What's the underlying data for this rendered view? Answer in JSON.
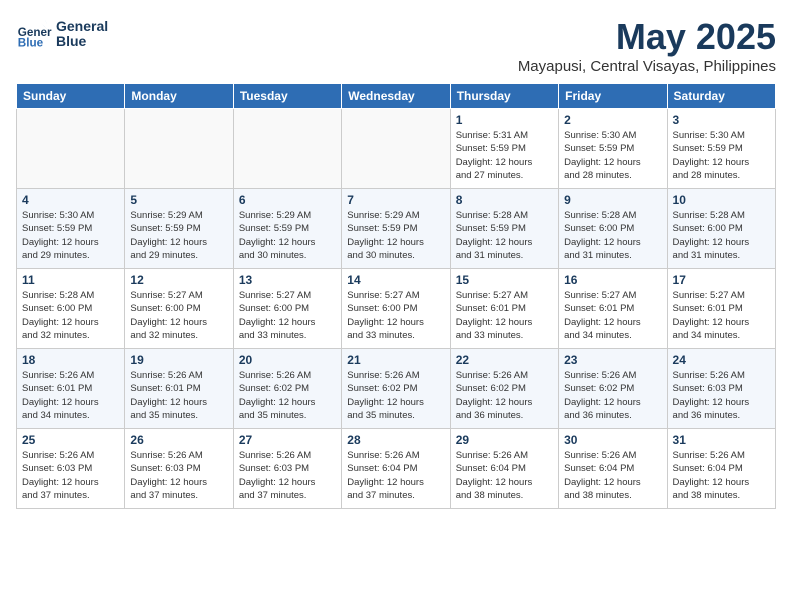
{
  "header": {
    "logo_line1": "General",
    "logo_line2": "Blue",
    "month_title": "May 2025",
    "location": "Mayapusi, Central Visayas, Philippines"
  },
  "weekdays": [
    "Sunday",
    "Monday",
    "Tuesday",
    "Wednesday",
    "Thursday",
    "Friday",
    "Saturday"
  ],
  "weeks": [
    [
      {
        "day": "",
        "info": ""
      },
      {
        "day": "",
        "info": ""
      },
      {
        "day": "",
        "info": ""
      },
      {
        "day": "",
        "info": ""
      },
      {
        "day": "1",
        "info": "Sunrise: 5:31 AM\nSunset: 5:59 PM\nDaylight: 12 hours\nand 27 minutes."
      },
      {
        "day": "2",
        "info": "Sunrise: 5:30 AM\nSunset: 5:59 PM\nDaylight: 12 hours\nand 28 minutes."
      },
      {
        "day": "3",
        "info": "Sunrise: 5:30 AM\nSunset: 5:59 PM\nDaylight: 12 hours\nand 28 minutes."
      }
    ],
    [
      {
        "day": "4",
        "info": "Sunrise: 5:30 AM\nSunset: 5:59 PM\nDaylight: 12 hours\nand 29 minutes."
      },
      {
        "day": "5",
        "info": "Sunrise: 5:29 AM\nSunset: 5:59 PM\nDaylight: 12 hours\nand 29 minutes."
      },
      {
        "day": "6",
        "info": "Sunrise: 5:29 AM\nSunset: 5:59 PM\nDaylight: 12 hours\nand 30 minutes."
      },
      {
        "day": "7",
        "info": "Sunrise: 5:29 AM\nSunset: 5:59 PM\nDaylight: 12 hours\nand 30 minutes."
      },
      {
        "day": "8",
        "info": "Sunrise: 5:28 AM\nSunset: 5:59 PM\nDaylight: 12 hours\nand 31 minutes."
      },
      {
        "day": "9",
        "info": "Sunrise: 5:28 AM\nSunset: 6:00 PM\nDaylight: 12 hours\nand 31 minutes."
      },
      {
        "day": "10",
        "info": "Sunrise: 5:28 AM\nSunset: 6:00 PM\nDaylight: 12 hours\nand 31 minutes."
      }
    ],
    [
      {
        "day": "11",
        "info": "Sunrise: 5:28 AM\nSunset: 6:00 PM\nDaylight: 12 hours\nand 32 minutes."
      },
      {
        "day": "12",
        "info": "Sunrise: 5:27 AM\nSunset: 6:00 PM\nDaylight: 12 hours\nand 32 minutes."
      },
      {
        "day": "13",
        "info": "Sunrise: 5:27 AM\nSunset: 6:00 PM\nDaylight: 12 hours\nand 33 minutes."
      },
      {
        "day": "14",
        "info": "Sunrise: 5:27 AM\nSunset: 6:00 PM\nDaylight: 12 hours\nand 33 minutes."
      },
      {
        "day": "15",
        "info": "Sunrise: 5:27 AM\nSunset: 6:01 PM\nDaylight: 12 hours\nand 33 minutes."
      },
      {
        "day": "16",
        "info": "Sunrise: 5:27 AM\nSunset: 6:01 PM\nDaylight: 12 hours\nand 34 minutes."
      },
      {
        "day": "17",
        "info": "Sunrise: 5:27 AM\nSunset: 6:01 PM\nDaylight: 12 hours\nand 34 minutes."
      }
    ],
    [
      {
        "day": "18",
        "info": "Sunrise: 5:26 AM\nSunset: 6:01 PM\nDaylight: 12 hours\nand 34 minutes."
      },
      {
        "day": "19",
        "info": "Sunrise: 5:26 AM\nSunset: 6:01 PM\nDaylight: 12 hours\nand 35 minutes."
      },
      {
        "day": "20",
        "info": "Sunrise: 5:26 AM\nSunset: 6:02 PM\nDaylight: 12 hours\nand 35 minutes."
      },
      {
        "day": "21",
        "info": "Sunrise: 5:26 AM\nSunset: 6:02 PM\nDaylight: 12 hours\nand 35 minutes."
      },
      {
        "day": "22",
        "info": "Sunrise: 5:26 AM\nSunset: 6:02 PM\nDaylight: 12 hours\nand 36 minutes."
      },
      {
        "day": "23",
        "info": "Sunrise: 5:26 AM\nSunset: 6:02 PM\nDaylight: 12 hours\nand 36 minutes."
      },
      {
        "day": "24",
        "info": "Sunrise: 5:26 AM\nSunset: 6:03 PM\nDaylight: 12 hours\nand 36 minutes."
      }
    ],
    [
      {
        "day": "25",
        "info": "Sunrise: 5:26 AM\nSunset: 6:03 PM\nDaylight: 12 hours\nand 37 minutes."
      },
      {
        "day": "26",
        "info": "Sunrise: 5:26 AM\nSunset: 6:03 PM\nDaylight: 12 hours\nand 37 minutes."
      },
      {
        "day": "27",
        "info": "Sunrise: 5:26 AM\nSunset: 6:03 PM\nDaylight: 12 hours\nand 37 minutes."
      },
      {
        "day": "28",
        "info": "Sunrise: 5:26 AM\nSunset: 6:04 PM\nDaylight: 12 hours\nand 37 minutes."
      },
      {
        "day": "29",
        "info": "Sunrise: 5:26 AM\nSunset: 6:04 PM\nDaylight: 12 hours\nand 38 minutes."
      },
      {
        "day": "30",
        "info": "Sunrise: 5:26 AM\nSunset: 6:04 PM\nDaylight: 12 hours\nand 38 minutes."
      },
      {
        "day": "31",
        "info": "Sunrise: 5:26 AM\nSunset: 6:04 PM\nDaylight: 12 hours\nand 38 minutes."
      }
    ]
  ]
}
